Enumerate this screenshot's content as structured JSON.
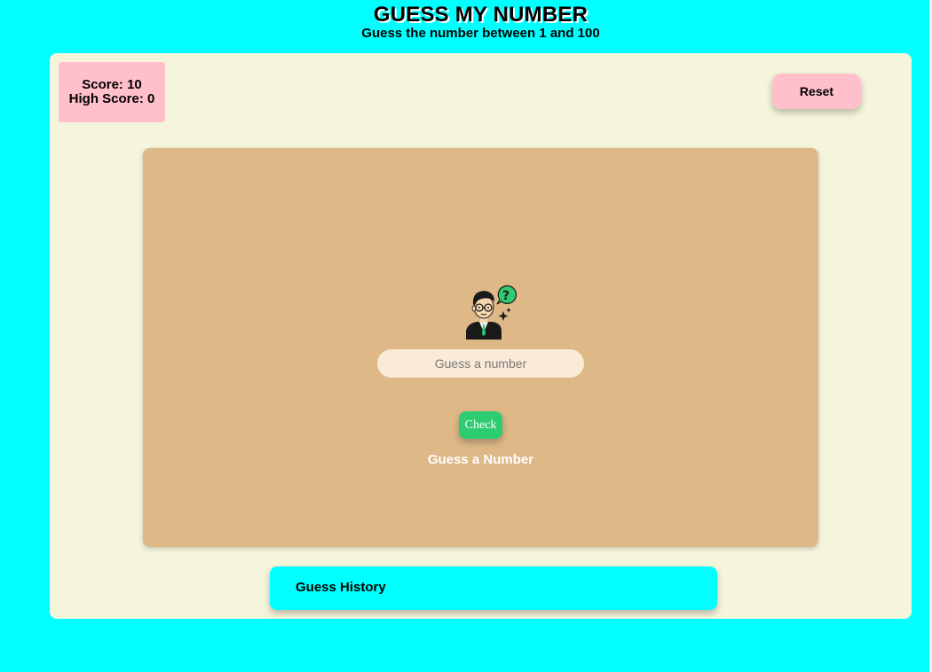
{
  "header": {
    "title": "GUESS MY NUMBER",
    "subtitle": "Guess the number between 1 and 100"
  },
  "score": {
    "score_text": "Score: 10",
    "high_score_text": "High Score: 0"
  },
  "controls": {
    "reset_label": "Reset",
    "check_label": "Check"
  },
  "game": {
    "input_value": "",
    "input_placeholder": "Guess a number",
    "message": "Guess a Number",
    "avatar_icon": "thinking-person-icon"
  },
  "history": {
    "title": "Guess History",
    "items": []
  },
  "colors": {
    "background": "#00ffff",
    "panel": "#f5f5dc",
    "card": "#deb887",
    "score_box": "#ffc0cb",
    "reset_button": "#ffc0cb",
    "check_button": "#2ecc71",
    "input": "#faebd7"
  }
}
